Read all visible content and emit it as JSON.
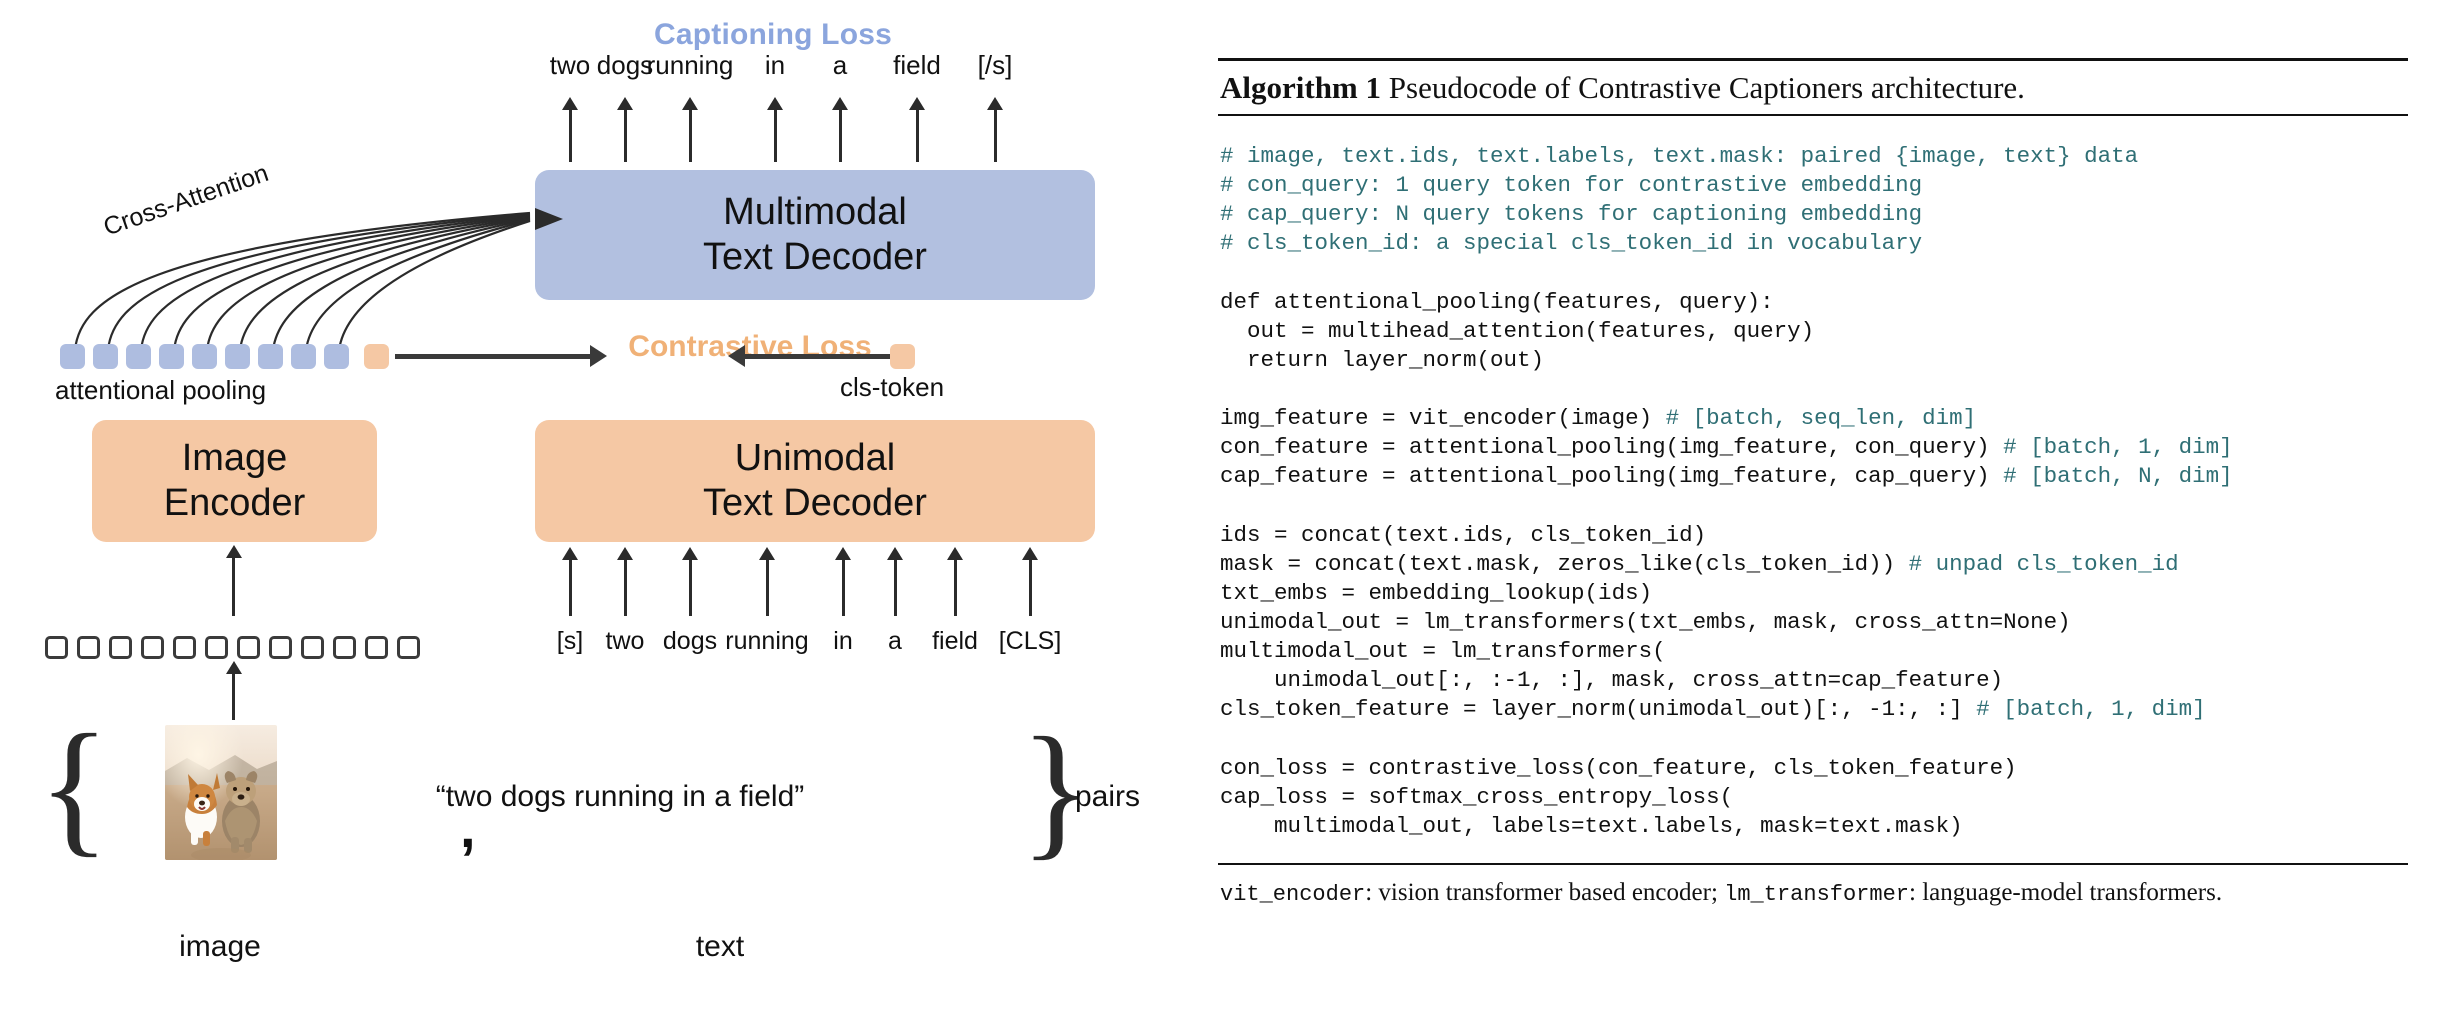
{
  "colors": {
    "captioning_loss": "#8ba5dd",
    "contrastive_loss": "#f0b177",
    "multimodal_block": "#b2c0e0",
    "encoder_block": "#f5c8a4",
    "pooled_token_blue": "#aebde0",
    "pooled_token_orange": "#f5c8a4",
    "comment": "#2f6f75",
    "arrow": "#3a3a3a"
  },
  "diagram": {
    "captioning_loss_label": "Captioning Loss",
    "contrastive_loss_label": "Contrastive Loss",
    "cross_attention_label": "Cross-Attention",
    "attentional_pooling_label": "attentional pooling",
    "cls_token_label": "cls-token",
    "caption_output_tokens": [
      "two",
      "dogs",
      "running",
      "in",
      "a",
      "field",
      "[/s]"
    ],
    "text_input_tokens": [
      "[s]",
      "two",
      "dogs",
      "running",
      "in",
      "a",
      "field",
      "[CLS]"
    ],
    "multimodal_decoder": {
      "line1": "Multimodal",
      "line2": "Text Decoder"
    },
    "image_encoder": {
      "line1": "Image",
      "line2": "Encoder"
    },
    "unimodal_decoder": {
      "line1": "Unimodal",
      "line2": "Text Decoder"
    },
    "caption_quote": "“two dogs running in a field”",
    "comma": ",",
    "pairs_label": "pairs",
    "image_label": "image",
    "text_label": "text",
    "pooled_token_count": 9,
    "patch_token_count": 12,
    "photo_alt": "two dogs running on a dirt path at sunset"
  },
  "algorithm": {
    "title_number": "Algorithm 1",
    "title_text": "Pseudocode of Contrastive Captioners architecture.",
    "code_lines": [
      [
        {
          "t": "# image, text.ids, text.labels, text.mask: paired {image, text} data",
          "c": true
        }
      ],
      [
        {
          "t": "# con_query: 1 query token for contrastive embedding",
          "c": true
        }
      ],
      [
        {
          "t": "# cap_query: N query tokens for captioning embedding",
          "c": true
        }
      ],
      [
        {
          "t": "# cls_token_id: a special cls_token_id in vocabulary",
          "c": true
        }
      ],
      [
        {
          "t": "",
          "c": false
        }
      ],
      [
        {
          "t": "def attentional_pooling(features, query):",
          "c": false
        }
      ],
      [
        {
          "t": "  out = multihead_attention(features, query)",
          "c": false
        }
      ],
      [
        {
          "t": "  return layer_norm(out)",
          "c": false
        }
      ],
      [
        {
          "t": "",
          "c": false
        }
      ],
      [
        {
          "t": "img_feature = vit_encoder(image) ",
          "c": false
        },
        {
          "t": "# [batch, seq_len, dim]",
          "c": true
        }
      ],
      [
        {
          "t": "con_feature = attentional_pooling(img_feature, con_query) ",
          "c": false
        },
        {
          "t": "# [batch, 1, dim]",
          "c": true
        }
      ],
      [
        {
          "t": "cap_feature = attentional_pooling(img_feature, cap_query) ",
          "c": false
        },
        {
          "t": "# [batch, N, dim]",
          "c": true
        }
      ],
      [
        {
          "t": "",
          "c": false
        }
      ],
      [
        {
          "t": "ids = concat(text.ids, cls_token_id)",
          "c": false
        }
      ],
      [
        {
          "t": "mask = concat(text.mask, zeros_like(cls_token_id)) ",
          "c": false
        },
        {
          "t": "# unpad cls_token_id",
          "c": true
        }
      ],
      [
        {
          "t": "txt_embs = embedding_lookup(ids)",
          "c": false
        }
      ],
      [
        {
          "t": "unimodal_out = lm_transformers(txt_embs, mask, cross_attn=None)",
          "c": false
        }
      ],
      [
        {
          "t": "multimodal_out = lm_transformers(",
          "c": false
        }
      ],
      [
        {
          "t": "    unimodal_out[:, :-1, :], mask, cross_attn=cap_feature)",
          "c": false
        }
      ],
      [
        {
          "t": "cls_token_feature = layer_norm(unimodal_out)[:, -1:, :] ",
          "c": false
        },
        {
          "t": "# [batch, 1, dim]",
          "c": true
        }
      ],
      [
        {
          "t": "",
          "c": false
        }
      ],
      [
        {
          "t": "con_loss = contrastive_loss(con_feature, cls_token_feature)",
          "c": false
        }
      ],
      [
        {
          "t": "cap_loss = softmax_cross_entropy_loss(",
          "c": false
        }
      ],
      [
        {
          "t": "    multimodal_out, labels=text.labels, mask=text.mask)",
          "c": false
        }
      ]
    ],
    "footnote_parts": [
      {
        "t": "vit_encoder",
        "mono": true
      },
      {
        "t": ": vision transformer based encoder; ",
        "mono": false
      },
      {
        "t": "lm_transformer",
        "mono": true
      },
      {
        "t": ": language-model transformers.",
        "mono": false
      }
    ]
  }
}
